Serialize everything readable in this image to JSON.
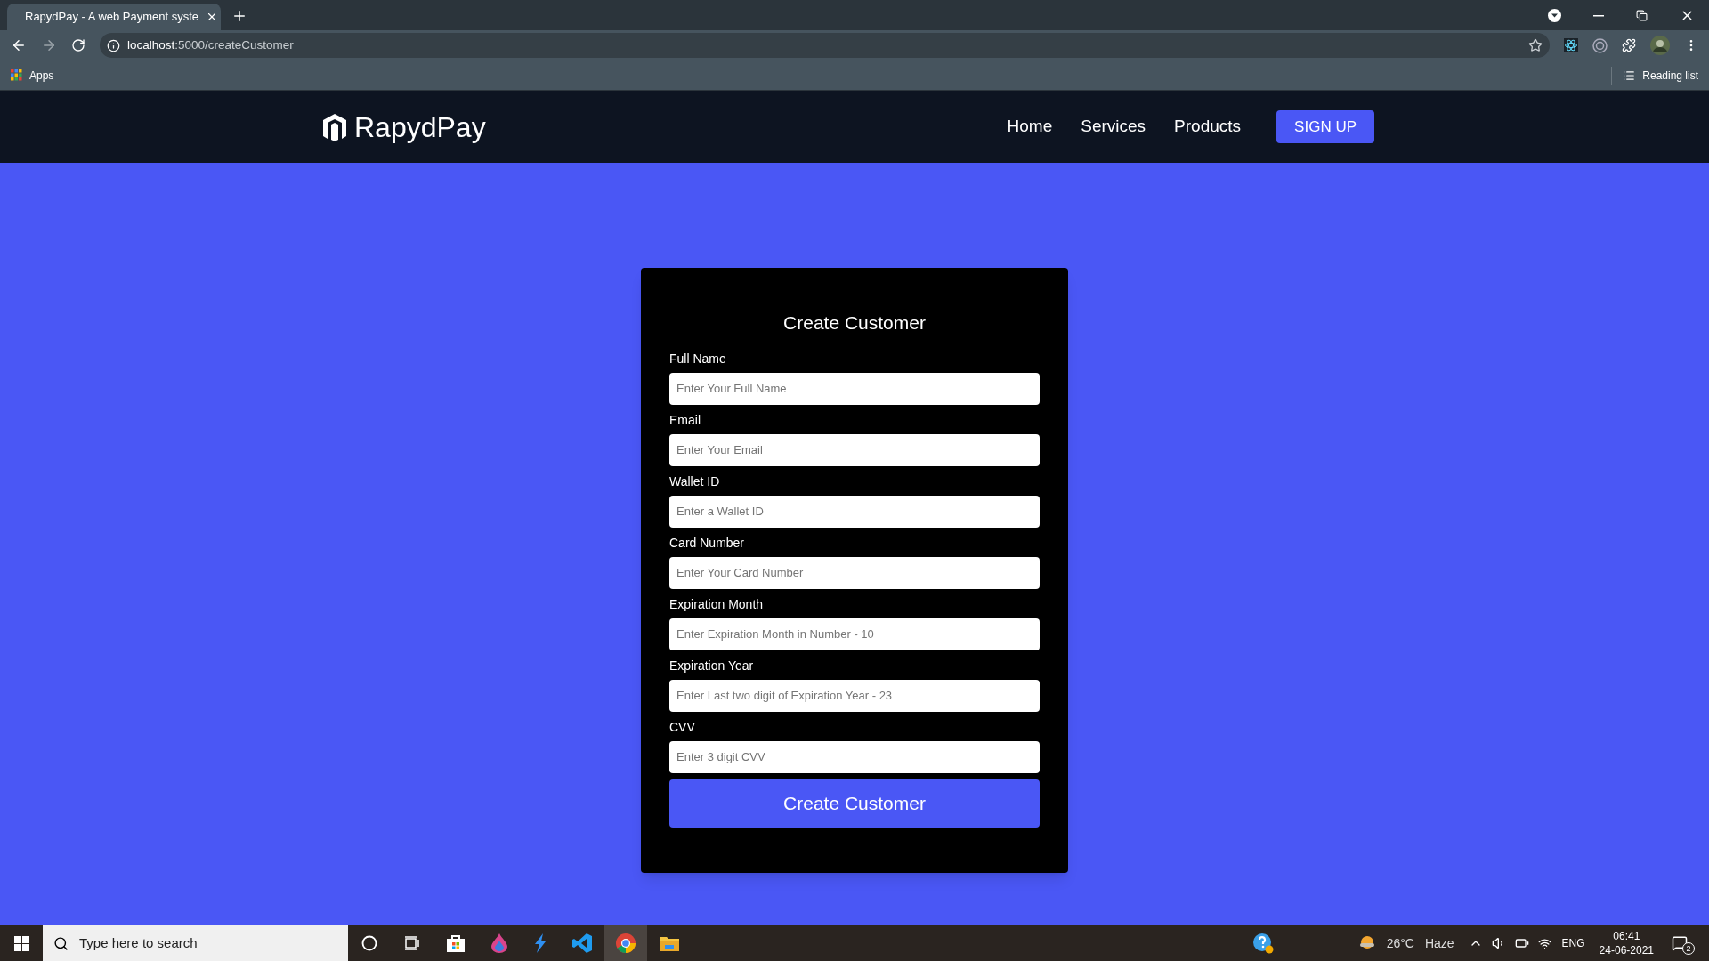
{
  "browser": {
    "tab": {
      "title": "RapydPay - A web Payment syste",
      "selected": true
    },
    "url_host": "localhost",
    "url_path": ":5000/createCustomer",
    "bookmarks": [
      "Apps"
    ],
    "reading_list": "Reading list"
  },
  "navbar": {
    "brand": "RapydPay",
    "links": [
      "Home",
      "Services",
      "Products"
    ],
    "cta": "SIGN UP"
  },
  "form": {
    "title": "Create Customer",
    "fields": [
      {
        "label": "Full Name",
        "placeholder": "Enter Your Full Name"
      },
      {
        "label": "Email",
        "placeholder": "Enter Your Email"
      },
      {
        "label": "Wallet ID",
        "placeholder": "Enter a Wallet ID"
      },
      {
        "label": "Card Number",
        "placeholder": "Enter Your Card Number"
      },
      {
        "label": "Expiration Month",
        "placeholder": "Enter Expiration Month in Number - 10"
      },
      {
        "label": "Expiration Year",
        "placeholder": "Enter Last two digit of Expiration Year - 23"
      },
      {
        "label": "CVV",
        "placeholder": "Enter 3 digit CVV"
      }
    ],
    "submit": "Create Customer"
  },
  "taskbar": {
    "search_placeholder": "Type here to search",
    "weather": "26°C",
    "condition": "Haze",
    "language": "ENG",
    "time": "06:41",
    "date": "24-06-2021",
    "notifications": "2"
  }
}
